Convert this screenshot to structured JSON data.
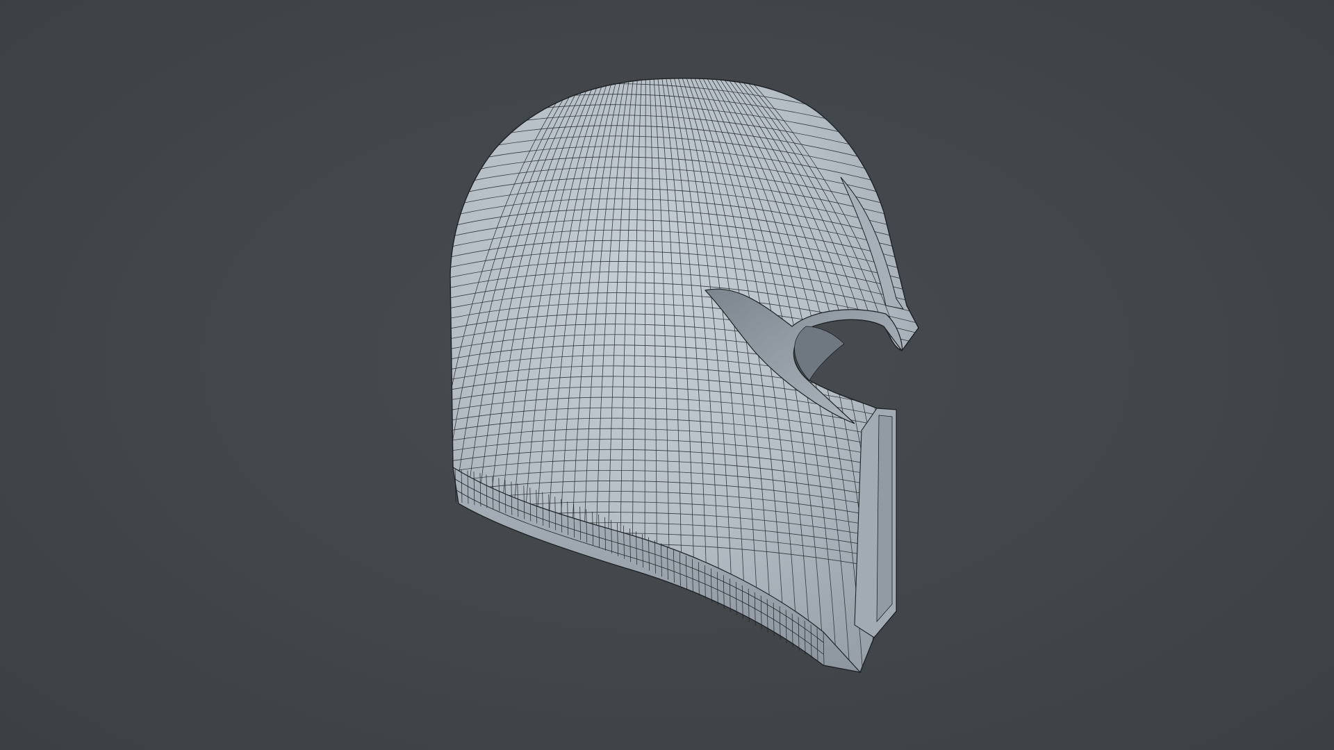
{
  "viewport": {
    "background_color": "#41464a",
    "model": {
      "subject": "helmet",
      "display_mode": "wireframe-on-shaded",
      "surface_color": "#b9c1c9",
      "wire_color": "#1d2226"
    }
  }
}
